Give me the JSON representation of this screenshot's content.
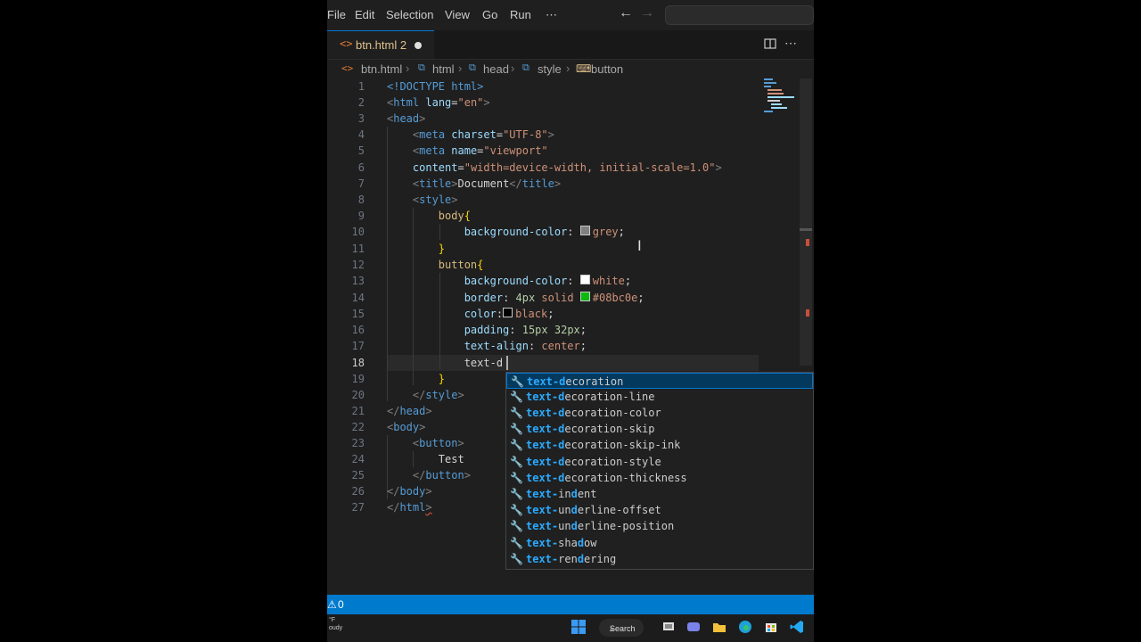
{
  "menubar": {
    "items": [
      "File",
      "Edit",
      "Selection",
      "View",
      "Go",
      "Run",
      "⋯"
    ],
    "back_arrow": "←",
    "forward_arrow": "→"
  },
  "tab": {
    "icon": "<>",
    "filename": "btn.html",
    "problems": "2"
  },
  "breadcrumb": [
    "btn.html",
    "html",
    "head",
    "style",
    "button"
  ],
  "editor": {
    "active_line": 18,
    "lines": [
      {
        "n": "1"
      },
      {
        "n": "2"
      },
      {
        "n": "3"
      },
      {
        "n": "4"
      },
      {
        "n": "5"
      },
      {
        "n": "6"
      },
      {
        "n": "7"
      },
      {
        "n": "8"
      },
      {
        "n": "9"
      },
      {
        "n": "10"
      },
      {
        "n": "11"
      },
      {
        "n": "12"
      },
      {
        "n": "13"
      },
      {
        "n": "14"
      },
      {
        "n": "15"
      },
      {
        "n": "16"
      },
      {
        "n": "17"
      },
      {
        "n": "18"
      },
      {
        "n": "19"
      },
      {
        "n": "20"
      },
      {
        "n": "21"
      },
      {
        "n": "22"
      },
      {
        "n": "23"
      },
      {
        "n": "24"
      },
      {
        "n": "25"
      },
      {
        "n": "26"
      },
      {
        "n": "27"
      }
    ],
    "text": {
      "l1_tag": "<!DOCTYPE html>",
      "l2_open": "<",
      "l2_tag": "html",
      "l2_attr": " lang",
      "l2_eq": "=",
      "l2_str": "\"en\"",
      "l2_close": ">",
      "l3_open": "<",
      "l3_tag": "head",
      "l3_close": ">",
      "l4_tag": "meta",
      "l4_attr": " charset",
      "l4_str": "\"UTF-8\"",
      "l5_tag": "meta",
      "l5_attr": " name",
      "l5_str": "\"viewport\"",
      "l6_attr": "content",
      "l6_str": "\"width=device-width, initial-scale=1.0\"",
      "l7_tag": "title",
      "l7_txt": "Document",
      "l7_endtag": "title",
      "l8_tag": "style",
      "l9_sel": "body",
      "l9_brace": "{",
      "l10_prop": "background-color",
      "l10_colon": ": ",
      "l10_val": "grey",
      "l10_semi": ";",
      "l11_brace": "}",
      "l12_sel": "button",
      "l12_brace": "{",
      "l13_prop": "background-color",
      "l13_val": "white",
      "l14_prop": "border",
      "l14_num": "4px",
      "l14_kw": " solid ",
      "l14_hex": "#08bc0e",
      "l15_prop": "color",
      "l15_val": "black",
      "l16_prop": "padding",
      "l16_num1": "15px",
      "l16_num2": "32px",
      "l17_prop": "text-align",
      "l17_val": "center",
      "l18_typed": "text-d",
      "l19_brace": "}",
      "l20_tag": "style",
      "l21_tag": "head",
      "l22_tag": "body",
      "l23_tag": "button",
      "l24_txt": "Test",
      "l25_tag": "button",
      "l26_tag": "body",
      "l27_tag": "html"
    },
    "swatch_colors": {
      "grey": "#808080",
      "white": "#ffffff",
      "green": "#08bc0e",
      "black": "#000000"
    }
  },
  "suggestions": [
    {
      "pre": "text-d",
      "rest": "ecoration"
    },
    {
      "pre": "text-d",
      "rest": "ecoration-line"
    },
    {
      "pre": "text-d",
      "rest": "ecoration-color"
    },
    {
      "pre": "text-d",
      "rest": "ecoration-skip"
    },
    {
      "pre": "text-d",
      "rest": "ecoration-skip-ink"
    },
    {
      "pre": "text-d",
      "rest": "ecoration-style"
    },
    {
      "pre": "text-d",
      "rest": "ecoration-thickness"
    },
    {
      "pre": "text-",
      "mid_a": "in",
      "mark2": "d",
      "rest": "ent"
    },
    {
      "pre": "text-",
      "mid_a": "un",
      "mark2": "d",
      "rest": "erline-offset"
    },
    {
      "pre": "text-",
      "mid_a": "un",
      "mark2": "d",
      "rest": "erline-position"
    },
    {
      "pre": "text-",
      "mid_a": "sha",
      "mark2": "d",
      "rest": "ow"
    },
    {
      "pre": "text-",
      "mid_a": "ren",
      "mark2": "d",
      "rest": "ering"
    }
  ],
  "statusbar": {
    "warnings": "0"
  },
  "taskbar": {
    "search_label": "Search",
    "weather_lines": [
      "°F",
      "oudy"
    ]
  },
  "colors": {
    "accent": "#007acc",
    "tag": "#569cd6",
    "prop": "#9cdcfe",
    "match": "#2aaaff"
  }
}
